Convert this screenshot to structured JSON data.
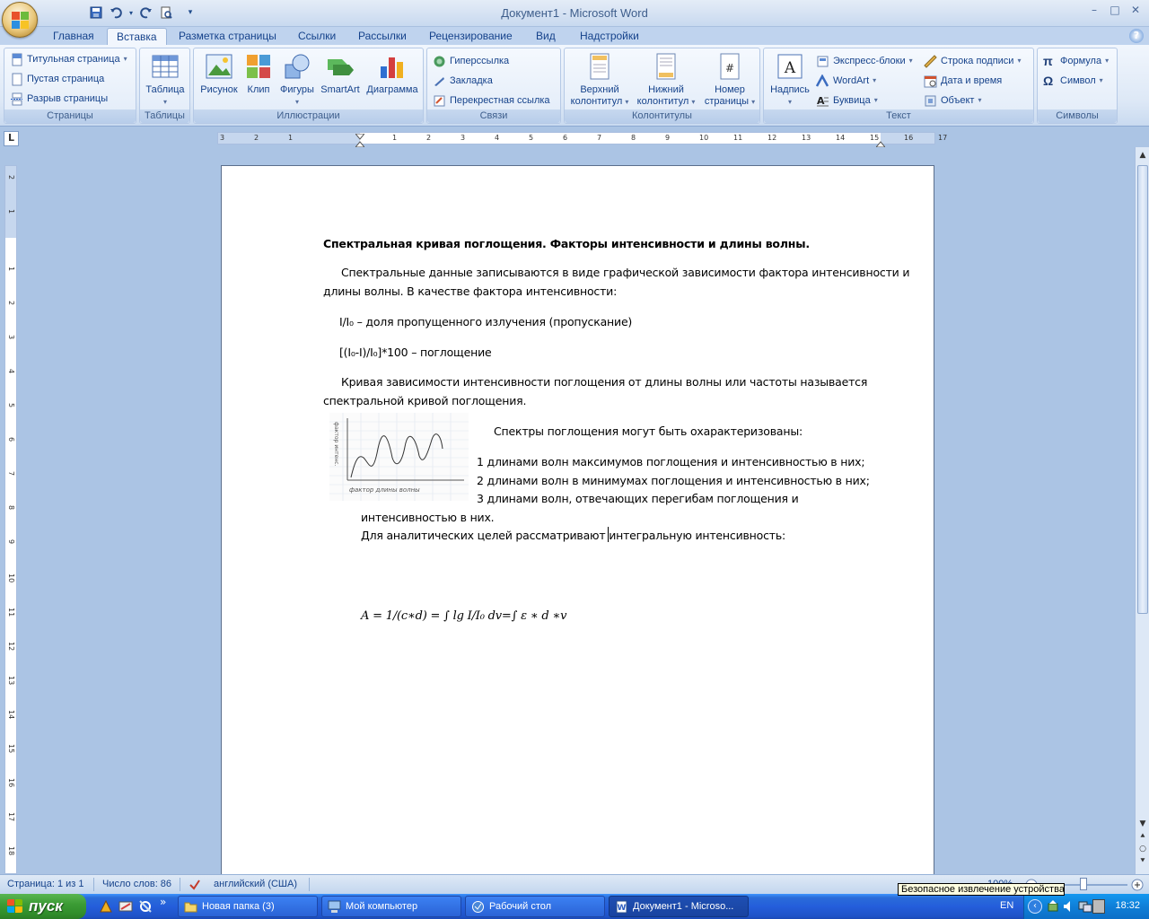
{
  "window": {
    "title": "Документ1 - Microsoft Word",
    "controls": {
      "minimize": "–",
      "maximize": "□",
      "close": "✕"
    }
  },
  "qat": {
    "save": "💾",
    "undo": "↶",
    "redo": "↺",
    "preview": "🔍",
    "customize": "▾"
  },
  "tabs": [
    "Главная",
    "Вставка",
    "Разметка страницы",
    "Ссылки",
    "Рассылки",
    "Рецензирование",
    "Вид",
    "Надстройки"
  ],
  "active_tab": "Вставка",
  "ribbon": {
    "pages": {
      "label": "Страницы",
      "items": [
        "Титульная страница",
        "Пустая страница",
        "Разрыв страницы"
      ]
    },
    "tables": {
      "label": "Таблицы",
      "table": "Таблица"
    },
    "illustrations": {
      "label": "Иллюстрации",
      "items": [
        "Рисунок",
        "Клип",
        "Фигуры",
        "SmartArt",
        "Диаграмма"
      ]
    },
    "links": {
      "label": "Связи",
      "items": [
        "Гиперссылка",
        "Закладка",
        "Перекрестная ссылка"
      ]
    },
    "headers": {
      "label": "Колонтитулы",
      "header_l1": "Верхний",
      "header_l2": "колонтитул",
      "footer_l1": "Нижний",
      "footer_l2": "колонтитул",
      "pagenum_l1": "Номер",
      "pagenum_l2": "страницы"
    },
    "text": {
      "label": "Текст",
      "textbox": "Надпись",
      "items_col1": [
        "Экспресс-блоки",
        "WordArt",
        "Буквица"
      ],
      "items_col2": [
        "Строка подписи",
        "Дата и время",
        "Объект"
      ]
    },
    "symbols": {
      "label": "Символы",
      "items": [
        "Формула",
        "Символ"
      ]
    }
  },
  "ruler": {
    "h_numbers": [
      "3",
      "2",
      "1",
      "1",
      "2",
      "3",
      "4",
      "5",
      "6",
      "7",
      "8",
      "9",
      "10",
      "11",
      "12",
      "13",
      "14",
      "15",
      "16",
      "17"
    ],
    "v_numbers": [
      "2",
      "1",
      "1",
      "2",
      "3",
      "4",
      "5",
      "6",
      "7",
      "8",
      "9",
      "10",
      "11",
      "12",
      "13",
      "14",
      "15",
      "16",
      "17",
      "18"
    ]
  },
  "document": {
    "heading": "Спектральная кривая поглощения. Факторы интенсивности и длины волны.",
    "p1_line1": "Спектральные данные записываются в виде графической зависимости фактора интенсивности и",
    "p1_line2": "длины волны. В качестве фактора интенсивности:",
    "p2": "I/I₀ – доля пропущенного излучения (пропускание)",
    "p3": "[(I₀-I)/I₀]*100 – поглощение",
    "p4_line1": "Кривая зависимости интенсивности поглощения от длины волны или частоты называется",
    "p4_line2": "спектральной кривой поглощения.",
    "p5": "Спектры поглощения могут быть охарактеризованы:",
    "list1": "1 длинами волн максимумов поглощения и интенсивностью в них;",
    "list2": "2 длинами волн в минимумах поглощения и интенсивностью в них;",
    "list3_line1": "3 длинами волн, отвечающих перегибам поглощения и",
    "list3_line2": "интенсивностью в них.",
    "p6": "Для аналитических целей рассматривают интегральную интенсивность:",
    "formula": "A = 1/(c∗d) = ∫ lg I/I₀ dv=∫ ε ∗ d ∗v",
    "sketch_y_label": "фактор интенс.",
    "sketch_x_label": "фактор длины волны"
  },
  "status": {
    "page": "Страница: 1 из 1",
    "words": "Число слов: 86",
    "language": "английский (США)",
    "zoom": "100%"
  },
  "tooltip": "Безопасное извлечение устройства",
  "taskbar": {
    "start": "пуск",
    "tasks": [
      "Новая папка (3)",
      "Мой компьютер",
      "Рабочий стол",
      "Документ1 - Microso..."
    ],
    "lang": "EN",
    "clock": "18:32",
    "chevron": "»"
  },
  "colors": {
    "ribbon_text": "#15428b",
    "taskbar_blue": "#245edb",
    "start_green": "#3c9c35"
  }
}
